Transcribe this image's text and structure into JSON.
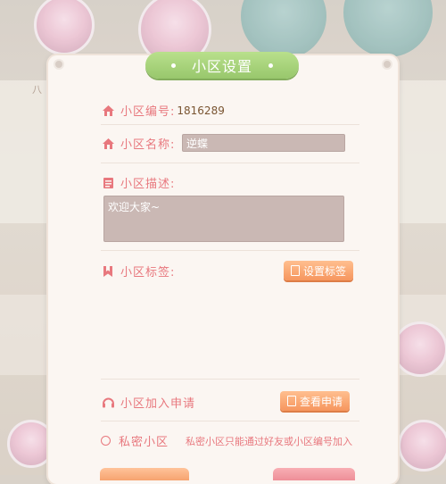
{
  "dialog": {
    "title": "小区设置",
    "id_label": "小区编号:",
    "id_value": "1816289",
    "name_label": "小区名称:",
    "name_value": "逆蝶",
    "desc_label": "小区描述:",
    "desc_value": "欢迎大家~",
    "tags_label": "小区标签:",
    "set_tags_button": "设置标签",
    "join_label": "小区加入申请",
    "view_requests_button": "查看申请",
    "private_label": "私密小区",
    "private_hint": "私密小区只能通过好友或小区编号加入",
    "private_checked": false
  },
  "background": {
    "label_left": "八",
    "colors": {
      "accent_pink": "#e8787e",
      "title_green": "#a9d47c",
      "button_orange": "#f7a06c"
    }
  }
}
